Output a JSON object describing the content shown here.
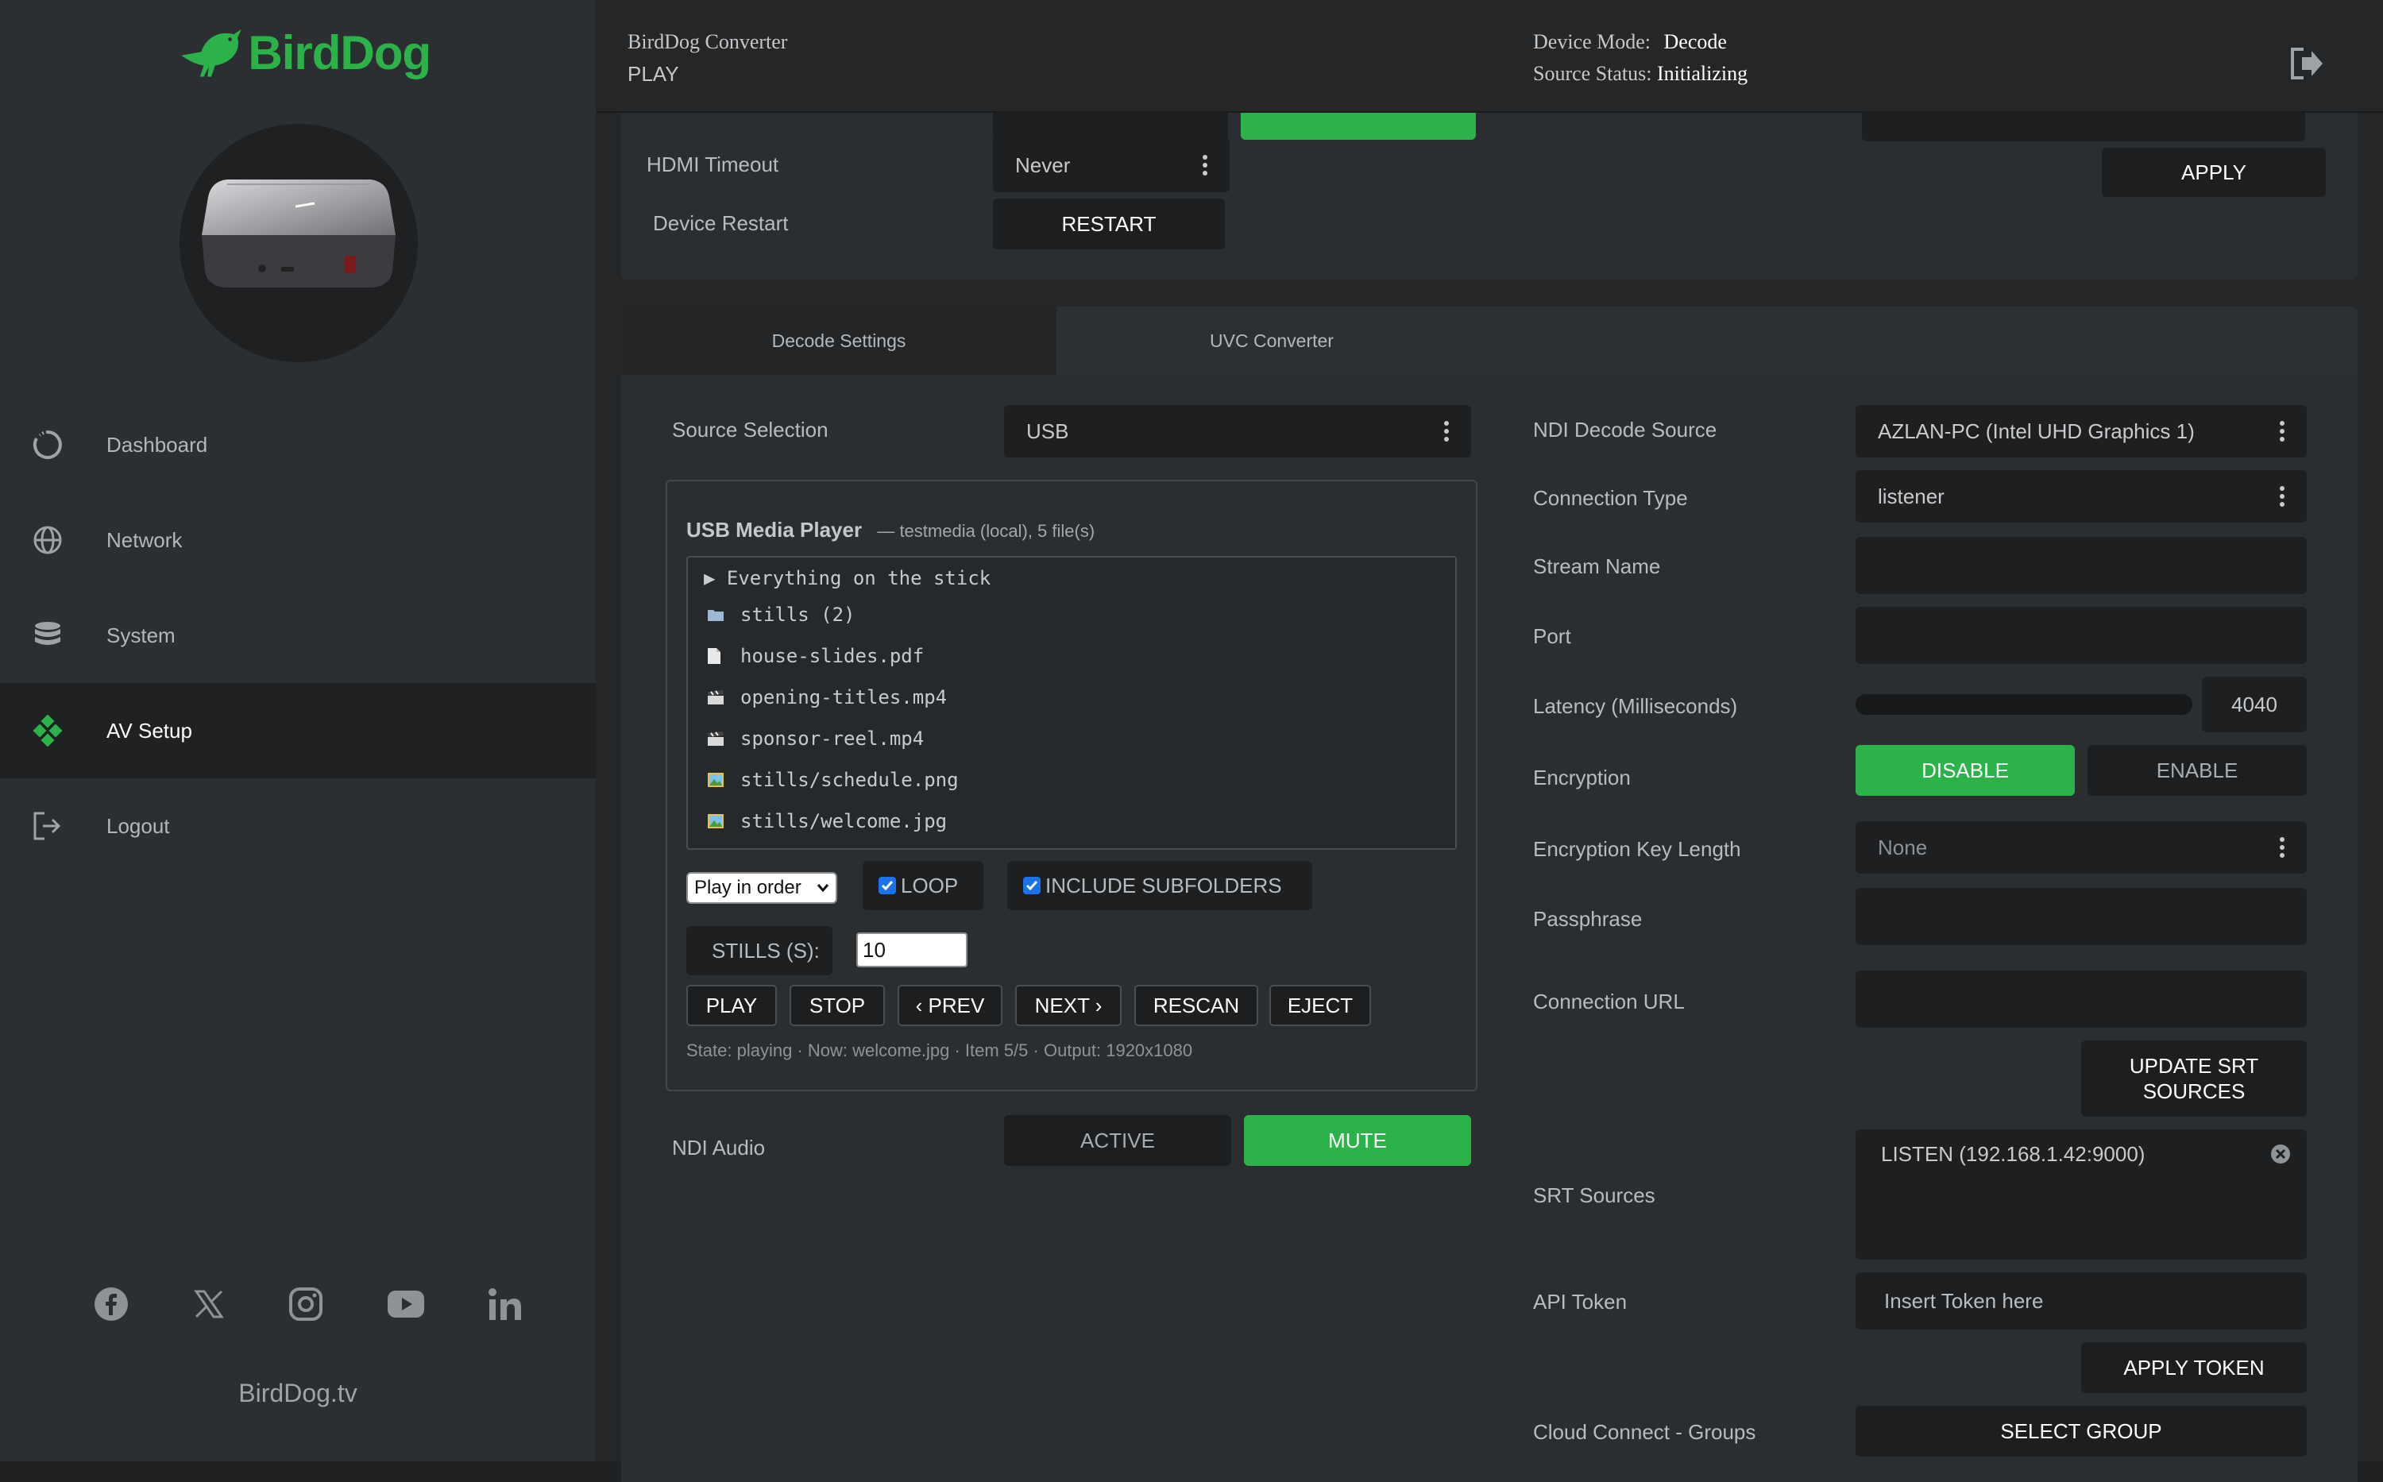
{
  "brand": {
    "name": "BirdDog",
    "site": "BirdDog.tv",
    "accent": "#2bb34a"
  },
  "sidebar": {
    "items": [
      {
        "label": "Dashboard",
        "icon": "dashboard-icon"
      },
      {
        "label": "Network",
        "icon": "globe-icon"
      },
      {
        "label": "System",
        "icon": "database-icon"
      },
      {
        "label": "AV Setup",
        "icon": "av-setup-icon",
        "active": true
      },
      {
        "label": "Logout",
        "icon": "logout-icon"
      }
    ],
    "social": [
      "facebook-icon",
      "x-icon",
      "instagram-icon",
      "youtube-icon",
      "linkedin-icon"
    ]
  },
  "header": {
    "product": "BirdDog Converter",
    "state": "PLAY",
    "device_mode_label": "Device Mode:",
    "device_mode": "Decode",
    "source_status_label": "Source Status:",
    "source_status": "Initializing"
  },
  "top_panel": {
    "hdmi_timeout_label": "HDMI Timeout",
    "hdmi_timeout_value": "Never",
    "device_restart_label": "Device Restart",
    "restart_label": "RESTART",
    "apply_label": "APPLY"
  },
  "tabs": [
    "Decode Settings",
    "UVC Converter"
  ],
  "left": {
    "source_selection_label": "Source Selection",
    "source_selection_value": "USB",
    "media_player": {
      "title": "USB Media Player",
      "subtitle": "— testmedia (local), 5 file(s)",
      "tree_root": "▶ Everything on the stick",
      "files": [
        {
          "name": "stills (2)",
          "icon": "folder-icon"
        },
        {
          "name": "house-slides.pdf",
          "icon": "document-icon"
        },
        {
          "name": "opening-titles.mp4",
          "icon": "clapperboard-icon"
        },
        {
          "name": "sponsor-reel.mp4",
          "icon": "clapperboard-icon"
        },
        {
          "name": "stills/schedule.png",
          "icon": "image-icon"
        },
        {
          "name": "stills/welcome.jpg",
          "icon": "image-icon"
        }
      ],
      "order_value": "Play in order",
      "loop_label": "LOOP",
      "subfolders_label": "INCLUDE SUBFOLDERS",
      "stills_label": "STILLS (S):",
      "stills_value": "10",
      "buttons": {
        "play": "PLAY",
        "stop": "STOP",
        "prev": "‹ PREV",
        "next": "NEXT ›",
        "rescan": "RESCAN",
        "eject": "EJECT"
      },
      "status": "State: playing · Now: welcome.jpg · Item 5/5 · Output: 1920x1080"
    },
    "ndi_audio_label": "NDI Audio",
    "active_label": "ACTIVE",
    "mute_label": "MUTE"
  },
  "right": {
    "ndi_decode_source_label": "NDI Decode Source",
    "ndi_decode_source_value": "AZLAN-PC (Intel UHD Graphics 1)",
    "connection_type_label": "Connection Type",
    "connection_type_value": "listener",
    "stream_name_label": "Stream Name",
    "port_label": "Port",
    "latency_label": "Latency (Milliseconds)",
    "latency_value": "4040",
    "encryption_label": "Encryption",
    "disable_label": "DISABLE",
    "enable_label": "ENABLE",
    "key_length_label": "Encryption Key Length",
    "key_length_value": "None",
    "passphrase_label": "Passphrase",
    "connection_url_label": "Connection URL",
    "update_srt_label": "UPDATE SRT SOURCES",
    "srt_sources_label": "SRT Sources",
    "srt_source_item": "LISTEN (192.168.1.42:9000)",
    "api_token_label": "API Token",
    "api_token_placeholder": "Insert Token here",
    "apply_token_label": "APPLY TOKEN",
    "cloud_groups_label": "Cloud Connect - Groups",
    "select_group_label": "SELECT GROUP"
  }
}
